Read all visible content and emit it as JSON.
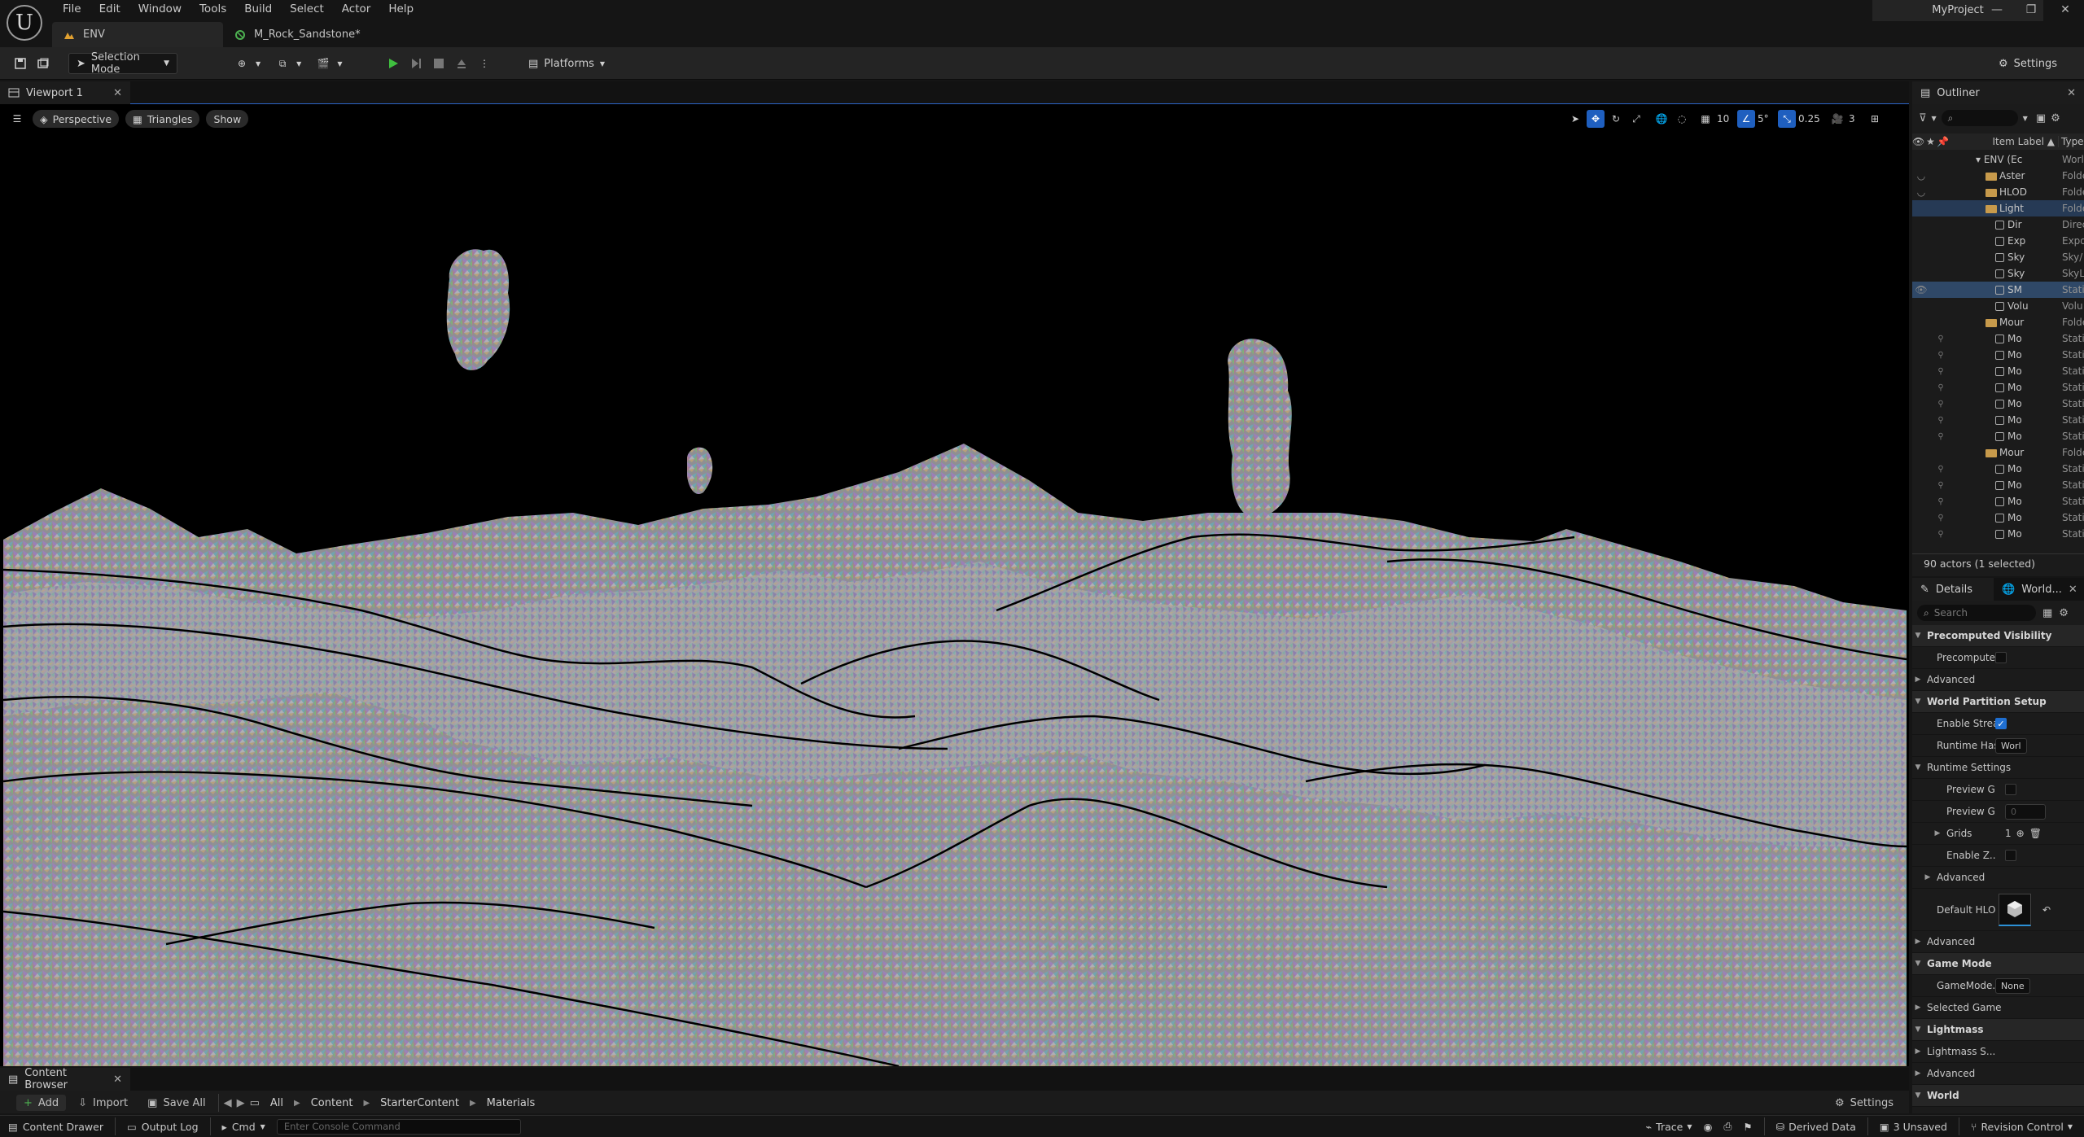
{
  "app": {
    "logo_letter": "U",
    "project": "MyProject"
  },
  "menu": [
    "File",
    "Edit",
    "Window",
    "Tools",
    "Build",
    "Select",
    "Actor",
    "Help"
  ],
  "doc_tabs": [
    {
      "label": "ENV",
      "active": true
    },
    {
      "label": "M_Rock_Sandstone*",
      "active": false
    }
  ],
  "window_controls": {
    "minimize": "—",
    "maximize": "❐",
    "close": "✕"
  },
  "toolbar": {
    "selection_mode": "Selection Mode",
    "platforms": "Platforms",
    "settings": "Settings"
  },
  "viewport": {
    "tab": "Viewport 1",
    "perspective": "Perspective",
    "view_mode": "Triangles",
    "show": "Show",
    "grid_snap": "10",
    "rot_snap": "5°",
    "scale_snap": "0.25",
    "camera_speed": "3"
  },
  "outliner": {
    "tab": "Outliner",
    "col_label": "Item Label ▲",
    "col_type": "Type",
    "rows": [
      {
        "label": "ENV (Ec",
        "type": "Worl",
        "kind": "world",
        "indent": 0,
        "eye": "",
        "pin": false,
        "sel": false
      },
      {
        "label": "Aster",
        "type": "Folde",
        "kind": "folder",
        "indent": 1,
        "eye": "◡",
        "pin": false,
        "sel": false
      },
      {
        "label": "HLOD",
        "type": "Folde",
        "kind": "folder",
        "indent": 1,
        "eye": "◡",
        "pin": false,
        "sel": false
      },
      {
        "label": "Light",
        "type": "Folde",
        "kind": "folder",
        "indent": 1,
        "eye": "",
        "pin": false,
        "sel": false,
        "hl": true
      },
      {
        "label": "Dir",
        "type": "Direc",
        "kind": "mesh",
        "indent": 2,
        "eye": "",
        "pin": false,
        "sel": false
      },
      {
        "label": "Exp",
        "type": "Expo",
        "kind": "mesh",
        "indent": 2,
        "eye": "",
        "pin": false,
        "sel": false
      },
      {
        "label": "Sky",
        "type": "Sky/",
        "kind": "mesh",
        "indent": 2,
        "eye": "",
        "pin": false,
        "sel": false
      },
      {
        "label": "Sky",
        "type": "SkyL",
        "kind": "mesh",
        "indent": 2,
        "eye": "",
        "pin": false,
        "sel": false
      },
      {
        "label": "SM",
        "type": "Stati",
        "kind": "mesh",
        "indent": 2,
        "eye": "👁",
        "pin": false,
        "sel": true
      },
      {
        "label": "Volu",
        "type": "Volu",
        "kind": "mesh",
        "indent": 2,
        "eye": "",
        "pin": false,
        "sel": false
      },
      {
        "label": "Mour",
        "type": "Folde",
        "kind": "folder",
        "indent": 1,
        "eye": "",
        "pin": false,
        "sel": false
      },
      {
        "label": "Mo",
        "type": "Stati",
        "kind": "mesh",
        "indent": 2,
        "eye": "",
        "pin": true,
        "sel": false
      },
      {
        "label": "Mo",
        "type": "Stati",
        "kind": "mesh",
        "indent": 2,
        "eye": "",
        "pin": true,
        "sel": false
      },
      {
        "label": "Mo",
        "type": "Stati",
        "kind": "mesh",
        "indent": 2,
        "eye": "",
        "pin": true,
        "sel": false
      },
      {
        "label": "Mo",
        "type": "Stati",
        "kind": "mesh",
        "indent": 2,
        "eye": "",
        "pin": true,
        "sel": false
      },
      {
        "label": "Mo",
        "type": "Stati",
        "kind": "mesh",
        "indent": 2,
        "eye": "",
        "pin": true,
        "sel": false
      },
      {
        "label": "Mo",
        "type": "Stati",
        "kind": "mesh",
        "indent": 2,
        "eye": "",
        "pin": true,
        "sel": false
      },
      {
        "label": "Mo",
        "type": "Stati",
        "kind": "mesh",
        "indent": 2,
        "eye": "",
        "pin": true,
        "sel": false
      },
      {
        "label": "Mour",
        "type": "Folde",
        "kind": "folder",
        "indent": 1,
        "eye": "",
        "pin": false,
        "sel": false
      },
      {
        "label": "Mo",
        "type": "Stati",
        "kind": "mesh",
        "indent": 2,
        "eye": "",
        "pin": true,
        "sel": false
      },
      {
        "label": "Mo",
        "type": "Stati",
        "kind": "mesh",
        "indent": 2,
        "eye": "",
        "pin": true,
        "sel": false
      },
      {
        "label": "Mo",
        "type": "Stati",
        "kind": "mesh",
        "indent": 2,
        "eye": "",
        "pin": true,
        "sel": false
      },
      {
        "label": "Mo",
        "type": "Stati",
        "kind": "mesh",
        "indent": 2,
        "eye": "",
        "pin": true,
        "sel": false
      },
      {
        "label": "Mo",
        "type": "Stati",
        "kind": "mesh",
        "indent": 2,
        "eye": "",
        "pin": true,
        "sel": false
      }
    ],
    "count": "90 actors (1 selected)"
  },
  "details": {
    "tab": "Details",
    "tab2": "World...",
    "search_placeholder": "Search",
    "rows": [
      {
        "label": "Precomputed Visibility",
        "kind": "cat",
        "indent": 0
      },
      {
        "label": "Precompute...",
        "kind": "check",
        "indent": 1,
        "checked": false
      },
      {
        "label": "Advanced",
        "kind": "sub",
        "indent": 0
      },
      {
        "label": "World Partition Setup",
        "kind": "cat",
        "indent": 0
      },
      {
        "label": "Enable Stream",
        "kind": "check",
        "indent": 1,
        "checked": true
      },
      {
        "label": "Runtime Hash",
        "kind": "dropdown",
        "indent": 1,
        "value": "Worl"
      },
      {
        "label": "Runtime Settings",
        "kind": "subopen",
        "indent": 0
      },
      {
        "label": "Preview Gri",
        "kind": "check",
        "indent": 2,
        "checked": false
      },
      {
        "label": "Preview Gri",
        "kind": "num",
        "indent": 2,
        "value": "0"
      },
      {
        "label": "Grids",
        "kind": "array",
        "indent": 2,
        "value": "1"
      },
      {
        "label": "Enable Z...",
        "kind": "check",
        "indent": 2,
        "checked": false
      },
      {
        "label": "Advanced",
        "kind": "sub",
        "indent": 1
      },
      {
        "label": "Default HLO...",
        "kind": "asset",
        "indent": 1
      },
      {
        "label": "Advanced",
        "kind": "sub",
        "indent": 0
      },
      {
        "label": "Game Mode",
        "kind": "cat",
        "indent": 0
      },
      {
        "label": "GameMode...",
        "kind": "dropdown",
        "indent": 1,
        "value": "None"
      },
      {
        "label": "Selected Game",
        "kind": "sub",
        "indent": 0
      },
      {
        "label": "Lightmass",
        "kind": "cat",
        "indent": 0
      },
      {
        "label": "Lightmass S...",
        "kind": "sub",
        "indent": 0
      },
      {
        "label": "Advanced",
        "kind": "sub",
        "indent": 0
      },
      {
        "label": "World",
        "kind": "cat",
        "indent": 0
      }
    ]
  },
  "content_browser": {
    "tab": "Content Browser",
    "add": "Add",
    "import": "Import",
    "save_all": "Save All",
    "breadcrumbs": [
      "All",
      "Content",
      "StarterContent",
      "Materials"
    ],
    "settings": "Settings"
  },
  "statusbar": {
    "content_drawer": "Content Drawer",
    "output_log": "Output Log",
    "cmd": "Cmd",
    "console_placeholder": "Enter Console Command",
    "trace": "Trace",
    "derived_data": "Derived Data",
    "unsaved": "3 Unsaved",
    "revision_control": "Revision Control"
  }
}
